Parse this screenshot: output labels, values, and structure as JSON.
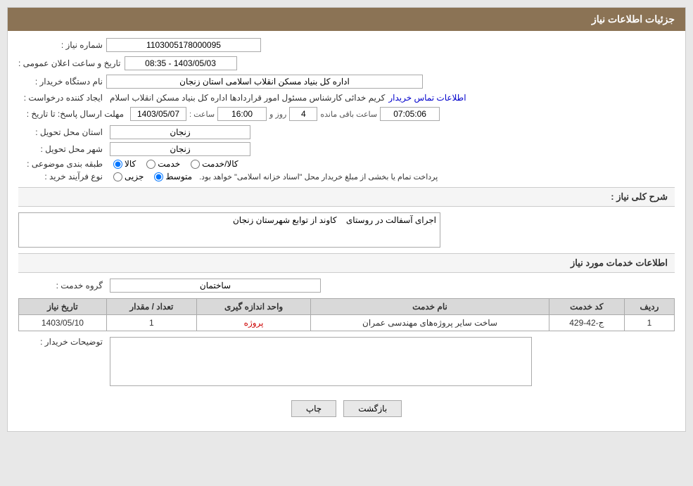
{
  "header": {
    "title": "جزئیات اطلاعات نیاز"
  },
  "fields": {
    "need_number_label": "شماره نیاز :",
    "need_number_value": "1103005178000095",
    "date_label": "تاریخ و ساعت اعلان عمومی :",
    "date_value": "1403/05/03 - 08:35",
    "org_name_label": "نام دستگاه خریدار :",
    "org_name_value": "اداره کل بنیاد مسکن انقلاب اسلامی استان زنجان",
    "creator_label": "ایجاد کننده درخواست :",
    "creator_value": "کریم خدائی کارشناس مسئول امور قراردادها اداره کل بنیاد مسکن انقلاب اسلام",
    "contact_link": "اطلاعات تماس خریدار",
    "deadline_label": "مهلت ارسال پاسخ: تا تاریخ :",
    "deadline_date": "1403/05/07",
    "deadline_time_label": "ساعت :",
    "deadline_time": "16:00",
    "deadline_day_label": "روز و",
    "deadline_days": "4",
    "deadline_remaining_label": "ساعت باقی مانده",
    "deadline_remaining": "07:05:06",
    "province_label": "استان محل تحویل :",
    "province_value": "زنجان",
    "city_label": "شهر محل تحویل :",
    "city_value": "زنجان",
    "category_label": "طبقه بندی موضوعی :",
    "category_options": [
      "کالا",
      "خدمت",
      "کالا/خدمت"
    ],
    "category_selected": "کالا",
    "process_label": "نوع فرآیند خرید :",
    "process_options": [
      "جزیی",
      "متوسط"
    ],
    "process_selected": "متوسط",
    "process_note": "پرداخت تمام یا بخشی از مبلغ خریدار محل \"اسناد خزانه اسلامی\" خواهد بود.",
    "description_section_label": "شرح کلی نیاز :",
    "description_value": "اجرای آسفالت در روستای    کاوند از توابع شهرستان زنجان",
    "services_section_label": "اطلاعات خدمات مورد نیاز",
    "service_group_label": "گروه خدمت :",
    "service_group_value": "ساختمان",
    "table": {
      "headers": [
        "ردیف",
        "کد خدمت",
        "نام خدمت",
        "واحد اندازه گیری",
        "تعداد / مقدار",
        "تاریخ نیاز"
      ],
      "rows": [
        {
          "row": "1",
          "code": "ج-42-429",
          "name": "ساخت سایر پروژه‌های مهندسی عمران",
          "unit": "پروژه",
          "quantity": "1",
          "date": "1403/05/10"
        }
      ]
    },
    "buyer_notes_label": "توضیحات خریدار :",
    "buyer_notes_value": ""
  },
  "buttons": {
    "print_label": "چاپ",
    "back_label": "بازگشت"
  }
}
